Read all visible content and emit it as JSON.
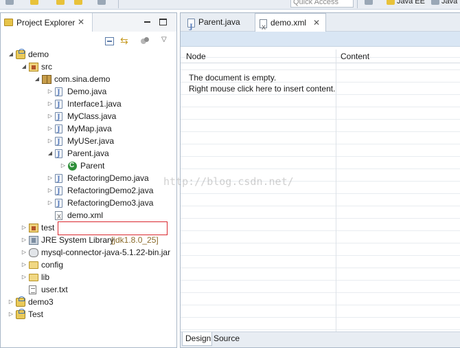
{
  "toolbar": {
    "quick_access_placeholder": "Quick Access",
    "perspectives": [
      {
        "label": "Java EE",
        "icon": "java-ee-perspective-icon"
      },
      {
        "label": "Java",
        "icon": "java-perspective-icon"
      }
    ]
  },
  "project_explorer": {
    "title": "Project Explorer",
    "close_glyph": "✕",
    "view_menu_glyph": "▽",
    "tree": [
      {
        "label": "demo",
        "icon": "project-icon",
        "twisty": "expanded"
      },
      {
        "label": "src",
        "icon": "source-folder-icon",
        "twisty": "expanded"
      },
      {
        "label": "com.sina.demo",
        "icon": "package-icon",
        "twisty": "expanded"
      },
      {
        "label": "Demo.java",
        "icon": "java-file-icon",
        "twisty": "collapsed"
      },
      {
        "label": "Interface1.java",
        "icon": "java-file-icon",
        "twisty": "collapsed"
      },
      {
        "label": "MyClass.java",
        "icon": "java-file-icon",
        "twisty": "collapsed"
      },
      {
        "label": "MyMap.java",
        "icon": "java-file-icon",
        "twisty": "collapsed"
      },
      {
        "label": "MyUSer.java",
        "icon": "java-file-icon",
        "twisty": "collapsed"
      },
      {
        "label": "Parent.java",
        "icon": "java-file-icon",
        "twisty": "expanded"
      },
      {
        "label": "Parent",
        "icon": "class-icon",
        "twisty": "collapsed"
      },
      {
        "label": "RefactoringDemo.java",
        "icon": "java-file-icon",
        "twisty": "collapsed"
      },
      {
        "label": "RefactoringDemo2.java",
        "icon": "java-file-icon",
        "twisty": "collapsed"
      },
      {
        "label": "RefactoringDemo3.java",
        "icon": "java-file-icon",
        "twisty": "collapsed"
      },
      {
        "label": "demo.xml",
        "icon": "xml-file-icon",
        "twisty": "none"
      },
      {
        "label": "test",
        "icon": "source-folder-icon",
        "twisty": "collapsed"
      },
      {
        "label": "JRE System Library",
        "decoration": "[jdk1.8.0_25]",
        "icon": "library-icon",
        "twisty": "collapsed"
      },
      {
        "label": "mysql-connector-java-5.1.22-bin.jar",
        "icon": "jar-icon",
        "twisty": "collapsed"
      },
      {
        "label": "config",
        "icon": "folder-icon",
        "twisty": "collapsed"
      },
      {
        "label": "lib",
        "icon": "folder-icon",
        "twisty": "collapsed"
      },
      {
        "label": "user.txt",
        "icon": "text-file-icon",
        "twisty": "none"
      },
      {
        "label": "demo3",
        "icon": "project-icon",
        "twisty": "collapsed"
      },
      {
        "label": "Test",
        "icon": "project-icon",
        "twisty": "collapsed"
      }
    ]
  },
  "editor": {
    "tabs": [
      {
        "label": "Parent.java",
        "active": false
      },
      {
        "label": "demo.xml",
        "active": true,
        "close_glyph": "✕"
      }
    ],
    "columns": {
      "node": "Node",
      "content": "Content"
    },
    "empty_line1": "The document is empty.",
    "empty_line2": "Right mouse click here to insert content.",
    "bottom_tabs": {
      "design": "Design",
      "source": "Source"
    }
  },
  "watermark": "http://blog.csdn.net/",
  "colors": {
    "highlight": "#d9272e",
    "accent": "#d9e6f4"
  }
}
